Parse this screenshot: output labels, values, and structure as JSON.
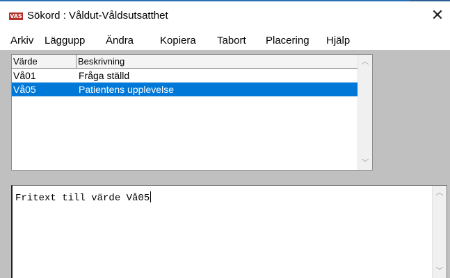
{
  "window": {
    "icon_label": "VAS",
    "title": "Sökord : Våldut-Våldsutsatthet",
    "close_glyph": "✕"
  },
  "menu": [
    "Arkiv",
    "Läggupp",
    "Ändra",
    "Kopiera",
    "Tabort",
    "Placering",
    "Hjälp"
  ],
  "list": {
    "columns": [
      "Värde",
      "Beskrivning"
    ],
    "rows": [
      {
        "value": "Vå01",
        "description": "Fråga ställd",
        "selected": false
      },
      {
        "value": "Vå05",
        "description": "Patientens upplevelse",
        "selected": true
      }
    ],
    "scroll_up": "︿",
    "scroll_down": "﹀"
  },
  "freetext": {
    "value": "Fritext till värde Vå05",
    "scroll_up": "︿",
    "scroll_down": "﹀"
  },
  "colors": {
    "selection": "#0078d7",
    "work_area": "#c0c0c0",
    "app_icon": "#b7312c"
  }
}
